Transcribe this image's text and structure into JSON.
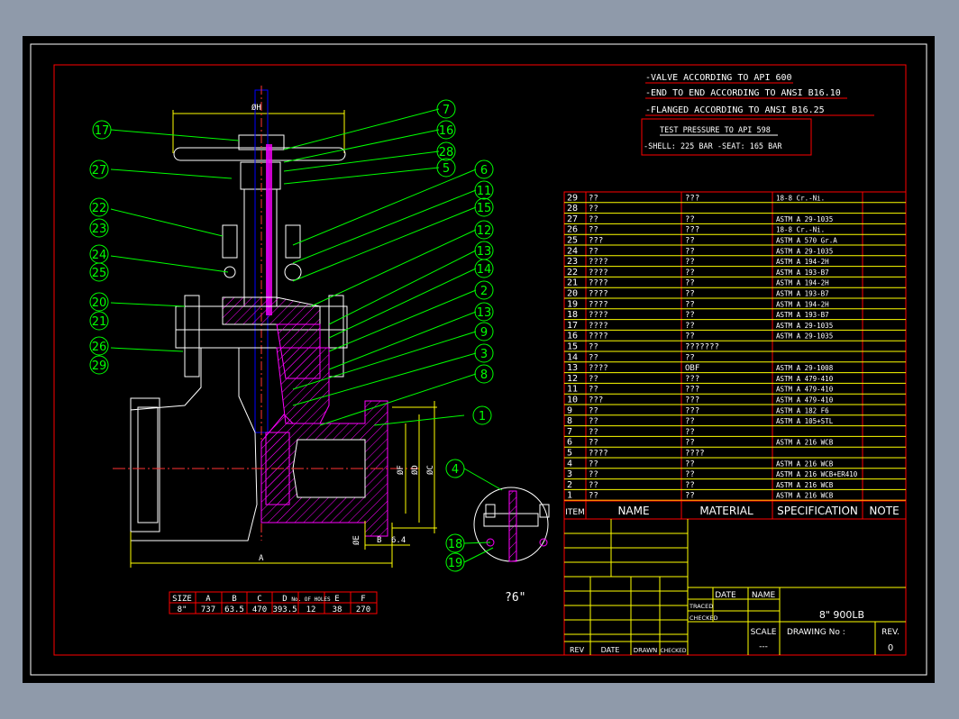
{
  "notes": {
    "line1": "-VALVE ACCORDING TO API 600",
    "line2": "-END TO END ACCORDING TO ANSI B16.10",
    "line3": "-FLANGED ACCORDING TO ANSI B16.25",
    "test_title": "TEST PRESSURE TO API 598",
    "test_values": "-SHELL: 225 BAR   -SEAT: 165 BAR"
  },
  "balloons": [
    "17",
    "27",
    "22",
    "23",
    "24",
    "25",
    "20",
    "21",
    "26",
    "29",
    "7",
    "16",
    "28",
    "5",
    "6",
    "11",
    "15",
    "12",
    "13",
    "14",
    "2",
    "13",
    "9",
    "3",
    "8",
    "1",
    "4",
    "18",
    "19"
  ],
  "dims": {
    "h": "ØH",
    "a": "A",
    "b": "B",
    "e": "ØE",
    "f": "ØF",
    "d": "ØD",
    "c": "ØC",
    "six_four": "6.4",
    "note_6": "?6\""
  },
  "size_table": {
    "headers": [
      "SIZE",
      "A",
      "B",
      "C",
      "D",
      "No. OF HOLES",
      "E",
      "F"
    ],
    "row": [
      "8\"",
      "737",
      "63.5",
      "470",
      "393.5",
      "12",
      "38",
      "270"
    ]
  },
  "parts_header": {
    "item": "ITEM",
    "name": "NAME",
    "material": "MATERIAL",
    "spec": "SPECIFICATION",
    "note": "NOTE"
  },
  "parts": [
    {
      "no": "29",
      "name": "??",
      "mat": "???",
      "spec": "18-8 Cr.-Ni."
    },
    {
      "no": "28",
      "name": "??",
      "mat": "",
      "spec": ""
    },
    {
      "no": "27",
      "name": "??",
      "mat": "??",
      "spec": "ASTM A 29-1035"
    },
    {
      "no": "26",
      "name": "??",
      "mat": "???",
      "spec": "18-8 Cr.-Ni."
    },
    {
      "no": "25",
      "name": "???",
      "mat": "??",
      "spec": "ASTM A 570 Gr.A"
    },
    {
      "no": "24",
      "name": "??",
      "mat": "??",
      "spec": "ASTM A 29-1035"
    },
    {
      "no": "23",
      "name": "????",
      "mat": "??",
      "spec": "ASTM A 194-2H"
    },
    {
      "no": "22",
      "name": "????",
      "mat": "??",
      "spec": "ASTM A 193-B7"
    },
    {
      "no": "21",
      "name": "????",
      "mat": "??",
      "spec": "ASTM A 194-2H"
    },
    {
      "no": "20",
      "name": "????",
      "mat": "??",
      "spec": "ASTM A 193-B7"
    },
    {
      "no": "19",
      "name": "????",
      "mat": "??",
      "spec": "ASTM A 194-2H"
    },
    {
      "no": "18",
      "name": "????",
      "mat": "??",
      "spec": "ASTM A 193-B7"
    },
    {
      "no": "17",
      "name": "????",
      "mat": "??",
      "spec": "ASTM A 29-1035"
    },
    {
      "no": "16",
      "name": "????",
      "mat": "??",
      "spec": "ASTM A 29-1035"
    },
    {
      "no": "15",
      "name": "??",
      "mat": "???????",
      "spec": ""
    },
    {
      "no": "14",
      "name": "??",
      "mat": "??",
      "spec": ""
    },
    {
      "no": "13",
      "name": "????",
      "mat": "OBF",
      "spec": "ASTM A 29-1008"
    },
    {
      "no": "12",
      "name": "??",
      "mat": "???",
      "spec": "ASTM A 479-410"
    },
    {
      "no": "11",
      "name": "??",
      "mat": "???",
      "spec": "ASTM A 479-410"
    },
    {
      "no": "10",
      "name": "???",
      "mat": "???",
      "spec": "ASTM A 479-410"
    },
    {
      "no": "9",
      "name": "??",
      "mat": "???",
      "spec": "ASTM A 182 F6"
    },
    {
      "no": "8",
      "name": "??",
      "mat": "??",
      "spec": "ASTM A 105+STL"
    },
    {
      "no": "7",
      "name": "??",
      "mat": "??",
      "spec": ""
    },
    {
      "no": "6",
      "name": "??",
      "mat": "??",
      "spec": "ASTM A 216 WCB"
    },
    {
      "no": "5",
      "name": "????",
      "mat": "????",
      "spec": ""
    },
    {
      "no": "4",
      "name": "??",
      "mat": "??",
      "spec": "ASTM A 216 WCB"
    },
    {
      "no": "3",
      "name": "??",
      "mat": "??",
      "spec": "ASTM A 216 WCB+ER410"
    },
    {
      "no": "2",
      "name": "??",
      "mat": "??",
      "spec": "ASTM A 216 WCB"
    },
    {
      "no": "1",
      "name": "??",
      "mat": "??",
      "spec": "ASTM A 216 WCB"
    }
  ],
  "title_block": {
    "date": "DATE",
    "name": "NAME",
    "traced": "TRACED",
    "checked": "CHECKED",
    "scale_label": "SCALE",
    "scale_value": "---",
    "drawing_no": "DRAWING No :",
    "rev_label": "REV.",
    "rev_value": "0",
    "title": "8\"  900LB",
    "rev_col": "REV",
    "date_col": "DATE",
    "drawn_col": "DRAWN",
    "checked_col": "CHECKED"
  },
  "colors": {
    "frame": "#ff0000",
    "outline": "#ffffff",
    "leader": "#00ff00",
    "hatch": "#ff00ff",
    "dim": "#ffff00",
    "center": "#ff3333",
    "stem": "#0000ff",
    "sheet": "#000000"
  }
}
